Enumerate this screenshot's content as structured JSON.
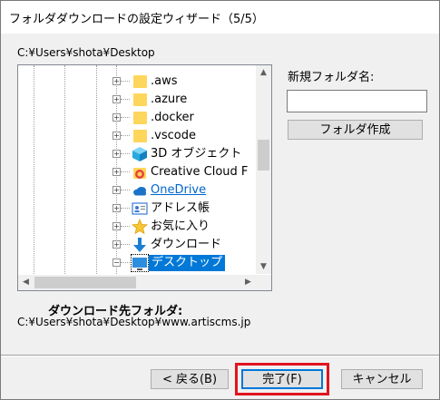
{
  "window": {
    "title": "フォルダダウンロードの設定ウィザード（5/5）"
  },
  "current_path": "C:¥Users¥shota¥Desktop",
  "tree": {
    "items": [
      {
        "label": ".aws",
        "icon": "folder-icon"
      },
      {
        "label": ".azure",
        "icon": "folder-icon"
      },
      {
        "label": ".docker",
        "icon": "folder-icon"
      },
      {
        "label": ".vscode",
        "icon": "folder-icon"
      },
      {
        "label": "3D オブジェクト",
        "icon": "3d-objects-icon"
      },
      {
        "label": "Creative Cloud F",
        "icon": "creative-cloud-icon"
      },
      {
        "label": "OneDrive",
        "icon": "onedrive-cloud-icon"
      },
      {
        "label": "アドレス帳",
        "icon": "contacts-icon"
      },
      {
        "label": "お気に入り",
        "icon": "favorites-star-icon"
      },
      {
        "label": "ダウンロード",
        "icon": "download-arrow-icon"
      },
      {
        "label": "デスクトップ",
        "icon": "desktop-icon"
      }
    ],
    "selected_index": 10
  },
  "new_folder": {
    "label": "新規フォルダ名:",
    "value": "",
    "create_button": "フォルダ作成"
  },
  "destination": {
    "label": "ダウンロード先フォルダ:",
    "path": "C:¥Users¥shota¥Desktop¥www.artiscms.jp"
  },
  "footer": {
    "back": "< 戻る(B)",
    "finish": "完了(F)",
    "cancel": "キャンセル"
  },
  "colors": {
    "selection": "#0078d7",
    "highlight_box": "#e1131e",
    "folder": "#ffd65c"
  }
}
